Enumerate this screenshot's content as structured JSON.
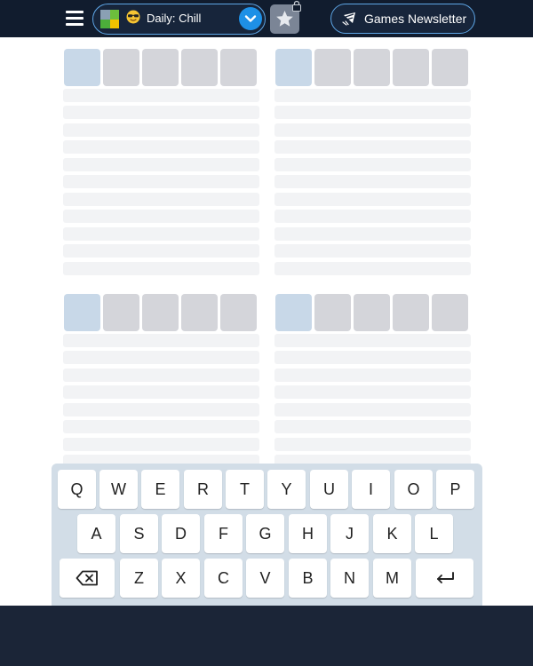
{
  "header": {
    "mode_label": "Daily: Chill",
    "newsletter_label": "Games Newsletter",
    "colors": {
      "bar": "#111c2e",
      "accent": "#1e90e6",
      "pill_border": "#5ea6e6"
    },
    "icons": [
      "hamburger-menu-icon",
      "game-logo-icon",
      "sunglasses-emoji-icon",
      "chevron-down-icon",
      "star-icon",
      "lock-icon",
      "newsletter-icon"
    ]
  },
  "boards": {
    "count": 4,
    "tiles_per_row": 5,
    "guess_rows_visible": 11,
    "colors": {
      "active_tile": "#c8d8e8",
      "empty_tile": "#d4d5da",
      "row": "#f2f3f5"
    }
  },
  "keyboard": {
    "rows": [
      [
        "Q",
        "W",
        "E",
        "R",
        "T",
        "Y",
        "U",
        "I",
        "O",
        "P"
      ],
      [
        "A",
        "S",
        "D",
        "F",
        "G",
        "H",
        "J",
        "K",
        "L"
      ],
      [
        "Z",
        "X",
        "C",
        "V",
        "B",
        "N",
        "M"
      ]
    ],
    "backspace_icon": "backspace-icon",
    "enter_icon": "enter-arrow-icon"
  }
}
